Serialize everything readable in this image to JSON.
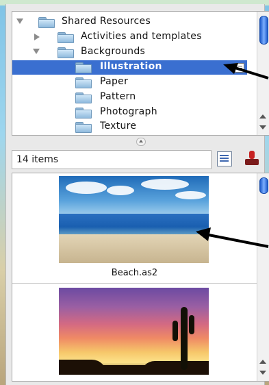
{
  "tree": {
    "items": [
      {
        "label": "Shared Resources",
        "arrow": "down"
      },
      {
        "label": "Activities and templates",
        "arrow": "right"
      },
      {
        "label": "Backgrounds",
        "arrow": "down"
      },
      {
        "label": "Illustration",
        "selected": true
      },
      {
        "label": "Paper"
      },
      {
        "label": "Pattern"
      },
      {
        "label": "Photograph"
      },
      {
        "label": "Texture"
      }
    ]
  },
  "status": {
    "count": "14 items"
  },
  "thumbnails": [
    {
      "name": "Beach.as2"
    },
    {
      "name": ""
    }
  ],
  "colors": {
    "selection": "#3a6fd0",
    "scroll_thumb": "#1b59c9"
  }
}
